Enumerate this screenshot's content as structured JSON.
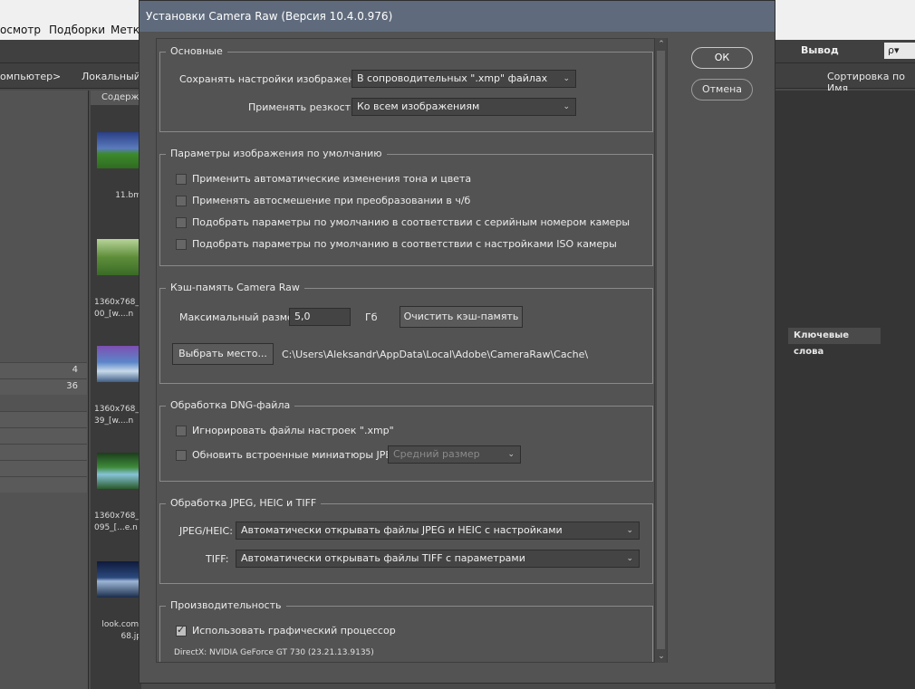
{
  "background": {
    "menu": [
      "осмотр",
      "Подборки",
      "Метк"
    ],
    "path": [
      "омпьютер",
      ">",
      "Локальный д"
    ],
    "content_header": "Содерж",
    "right_toolbar": {
      "output": "Вывод",
      "search": "ρ▾"
    },
    "sort": "Сортировка по Имя",
    "keywords_tab": "Ключевые слова",
    "left_counts": [
      "4",
      "36"
    ],
    "thumbs": [
      {
        "caption": "11.bm"
      },
      {
        "caption": "1360x768_\n00_[w....n"
      },
      {
        "caption": "1360x768_\n39_[w....n"
      },
      {
        "caption": "1360x768_\n095_[...e.n"
      },
      {
        "caption": "look.com.\n68.jp"
      }
    ]
  },
  "dialog": {
    "title": "Установки Camera Raw  (Версия 10.4.0.976)",
    "ok": "ОК",
    "cancel": "Отмена",
    "general": {
      "legend": "Основные",
      "save_label": "Сохранять настройки изображений:",
      "save_value": "В сопроводительных \".xmp\" файлах",
      "sharpen_label": "Применять резкость:",
      "sharpen_value": "Ко всем изображениям"
    },
    "defaults": {
      "legend": "Параметры изображения по умолчанию",
      "items": [
        {
          "label": "Применить автоматические изменения тона и цвета",
          "checked": false
        },
        {
          "label": "Применять автосмешение при преобразовании в ч/б",
          "checked": false
        },
        {
          "label": "Подобрать параметры по умолчанию в соответствии с серийным номером камеры",
          "checked": false
        },
        {
          "label": "Подобрать параметры по умолчанию в соответствии с настройками ISO камеры",
          "checked": false
        }
      ]
    },
    "cache": {
      "legend": "Кэш-память Camera Raw",
      "max_label": "Максимальный размер:",
      "max_value": "5,0",
      "unit": "Гб",
      "purge": "Очистить кэш-память",
      "choose": "Выбрать место...",
      "path": "C:\\Users\\Aleksandr\\AppData\\Local\\Adobe\\CameraRaw\\Cache\\"
    },
    "dng": {
      "legend": "Обработка DNG-файла",
      "ignore_label": "Игнорировать файлы настроек \".xmp\"",
      "ignore_checked": false,
      "update_label": "Обновить встроенные миниатюры JPEG:",
      "update_checked": false,
      "update_value": "Средний размер"
    },
    "jpeg": {
      "legend": "Обработка JPEG, HEIC и TIFF",
      "jpeg_label": "JPEG/HEIC:",
      "jpeg_value": "Автоматически открывать файлы JPEG и HEIC с настройками",
      "tiff_label": "TIFF:",
      "tiff_value": "Автоматически открывать файлы TIFF с параметрами"
    },
    "perf": {
      "legend": "Производительность",
      "gpu_label": "Использовать графический процессор",
      "gpu_checked": true,
      "gpu_info": "DirectX: NVIDIA GeForce GT 730 (23.21.13.9135)"
    }
  }
}
